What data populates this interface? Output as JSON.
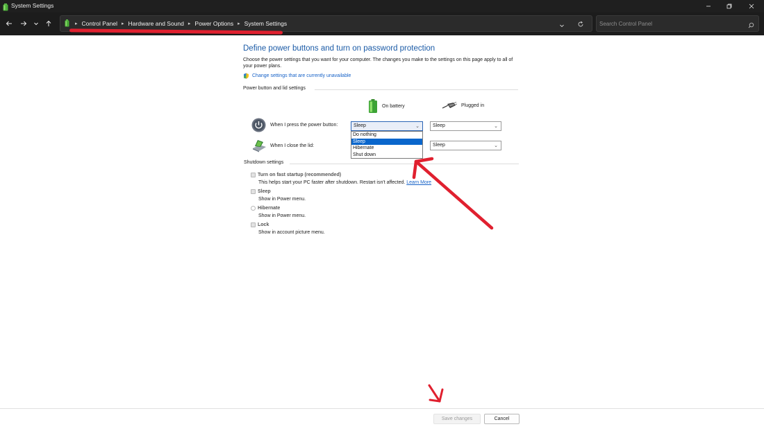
{
  "window": {
    "title": "System Settings"
  },
  "breadcrumbs": [
    "Control Panel",
    "Hardware and Sound",
    "Power Options",
    "System Settings"
  ],
  "search": {
    "placeholder": "Search Control Panel"
  },
  "page": {
    "heading": "Define power buttons and turn on password protection",
    "description": "Choose the power settings that you want for your computer. The changes you make to the settings on this page apply to all of your power plans.",
    "change_link": "Change settings that are currently unavailable"
  },
  "power_section": {
    "title": "Power button and lid settings",
    "col_battery": "On battery",
    "col_plugged": "Plugged in",
    "power_button_label": "When I press the power button:",
    "power_button_battery": "Sleep",
    "power_button_plugged": "Sleep",
    "lid_label": "When I close the lid:",
    "lid_plugged": "Sleep",
    "dropdown_options": [
      "Do nothing",
      "Sleep",
      "Hibernate",
      "Shut down"
    ],
    "dropdown_selected": "Sleep"
  },
  "shutdown_section": {
    "title": "Shutdown settings",
    "fast_startup_label": "Turn on fast startup (recommended)",
    "fast_startup_desc": "This helps start your PC faster after shutdown. Restart isn't affected.",
    "fast_startup_link": "Learn More",
    "sleep_label": "Sleep",
    "sleep_desc": "Show in Power menu.",
    "hibernate_label": "Hibernate",
    "hibernate_desc": "Show in Power menu.",
    "lock_label": "Lock",
    "lock_desc": "Show in account picture menu."
  },
  "buttons": {
    "save": "Save changes",
    "cancel": "Cancel"
  },
  "colors": {
    "annotation": "#e0202f",
    "heading": "#1a5aa6",
    "link": "#1561c7",
    "selection": "#0a66cc"
  }
}
